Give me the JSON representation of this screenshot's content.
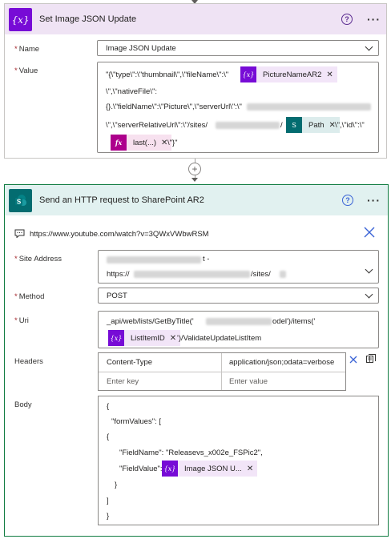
{
  "set_variable": {
    "title": "Set Image JSON Update",
    "help": "?",
    "more": "···",
    "name_label": "Name",
    "name_value": "Image JSON Update",
    "value_label": "Value",
    "value_line1": "\"{\\\"type\\\":\\\"thumbnail\\\",\\\"fileName\\\":\\\"",
    "value_line2": "\\\",\\\"nativeFile\\\":",
    "value_line3_a": "{}.\\\"fieldName\\\":\\\"Picture\\\",\\\"serverUrl\\\":\\\"",
    "value_line4_a": "\\\",\\\"serverRelativeUrl\\\":\\\"/sites/",
    "value_line4_b": "/",
    "value_line4_c": "\\\",\\\"id\\\":\\\"",
    "value_line5": "\\\"}\"",
    "tokens": {
      "picture_name": "PictureNameAR2",
      "path": "Path",
      "last": "last(...)"
    }
  },
  "http": {
    "title": "Send an HTTP request to SharePoint AR2",
    "help": "?",
    "more": "···",
    "comment": "https://www.youtube.com/watch?v=3QWxVWbwRSM",
    "site_label": "Site Address",
    "site_line1_end": "t -",
    "site_line2_a": "https://",
    "site_line2_b": "/sites/",
    "method_label": "Method",
    "method_value": "POST",
    "uri_label": "Uri",
    "uri_line1_a": "_api/web/lists/GetByTitle('",
    "uri_line1_b": "odel')/items('",
    "uri_token": "ListItemID",
    "uri_line2_end": "')/ValidateUpdateListItem",
    "headers_label": "Headers",
    "header_key": "Content-Type",
    "header_value": "application/json;odata=verbose",
    "header_key_placeholder": "Enter key",
    "header_value_placeholder": "Enter value",
    "body_label": "Body",
    "body_lines": [
      "{",
      "\"formValues\":  [",
      "{",
      "\"FieldName\": \"Releasevs_x002e_FSPic2\",",
      "\"FieldValue\":",
      "}",
      "]",
      "}"
    ],
    "body_token": "Image JSON U..."
  },
  "add_step": "+",
  "colors": {
    "variable": "#770bd6",
    "sharepoint": "#036c70",
    "expression": "#ad008c",
    "required": "#a4262c"
  }
}
